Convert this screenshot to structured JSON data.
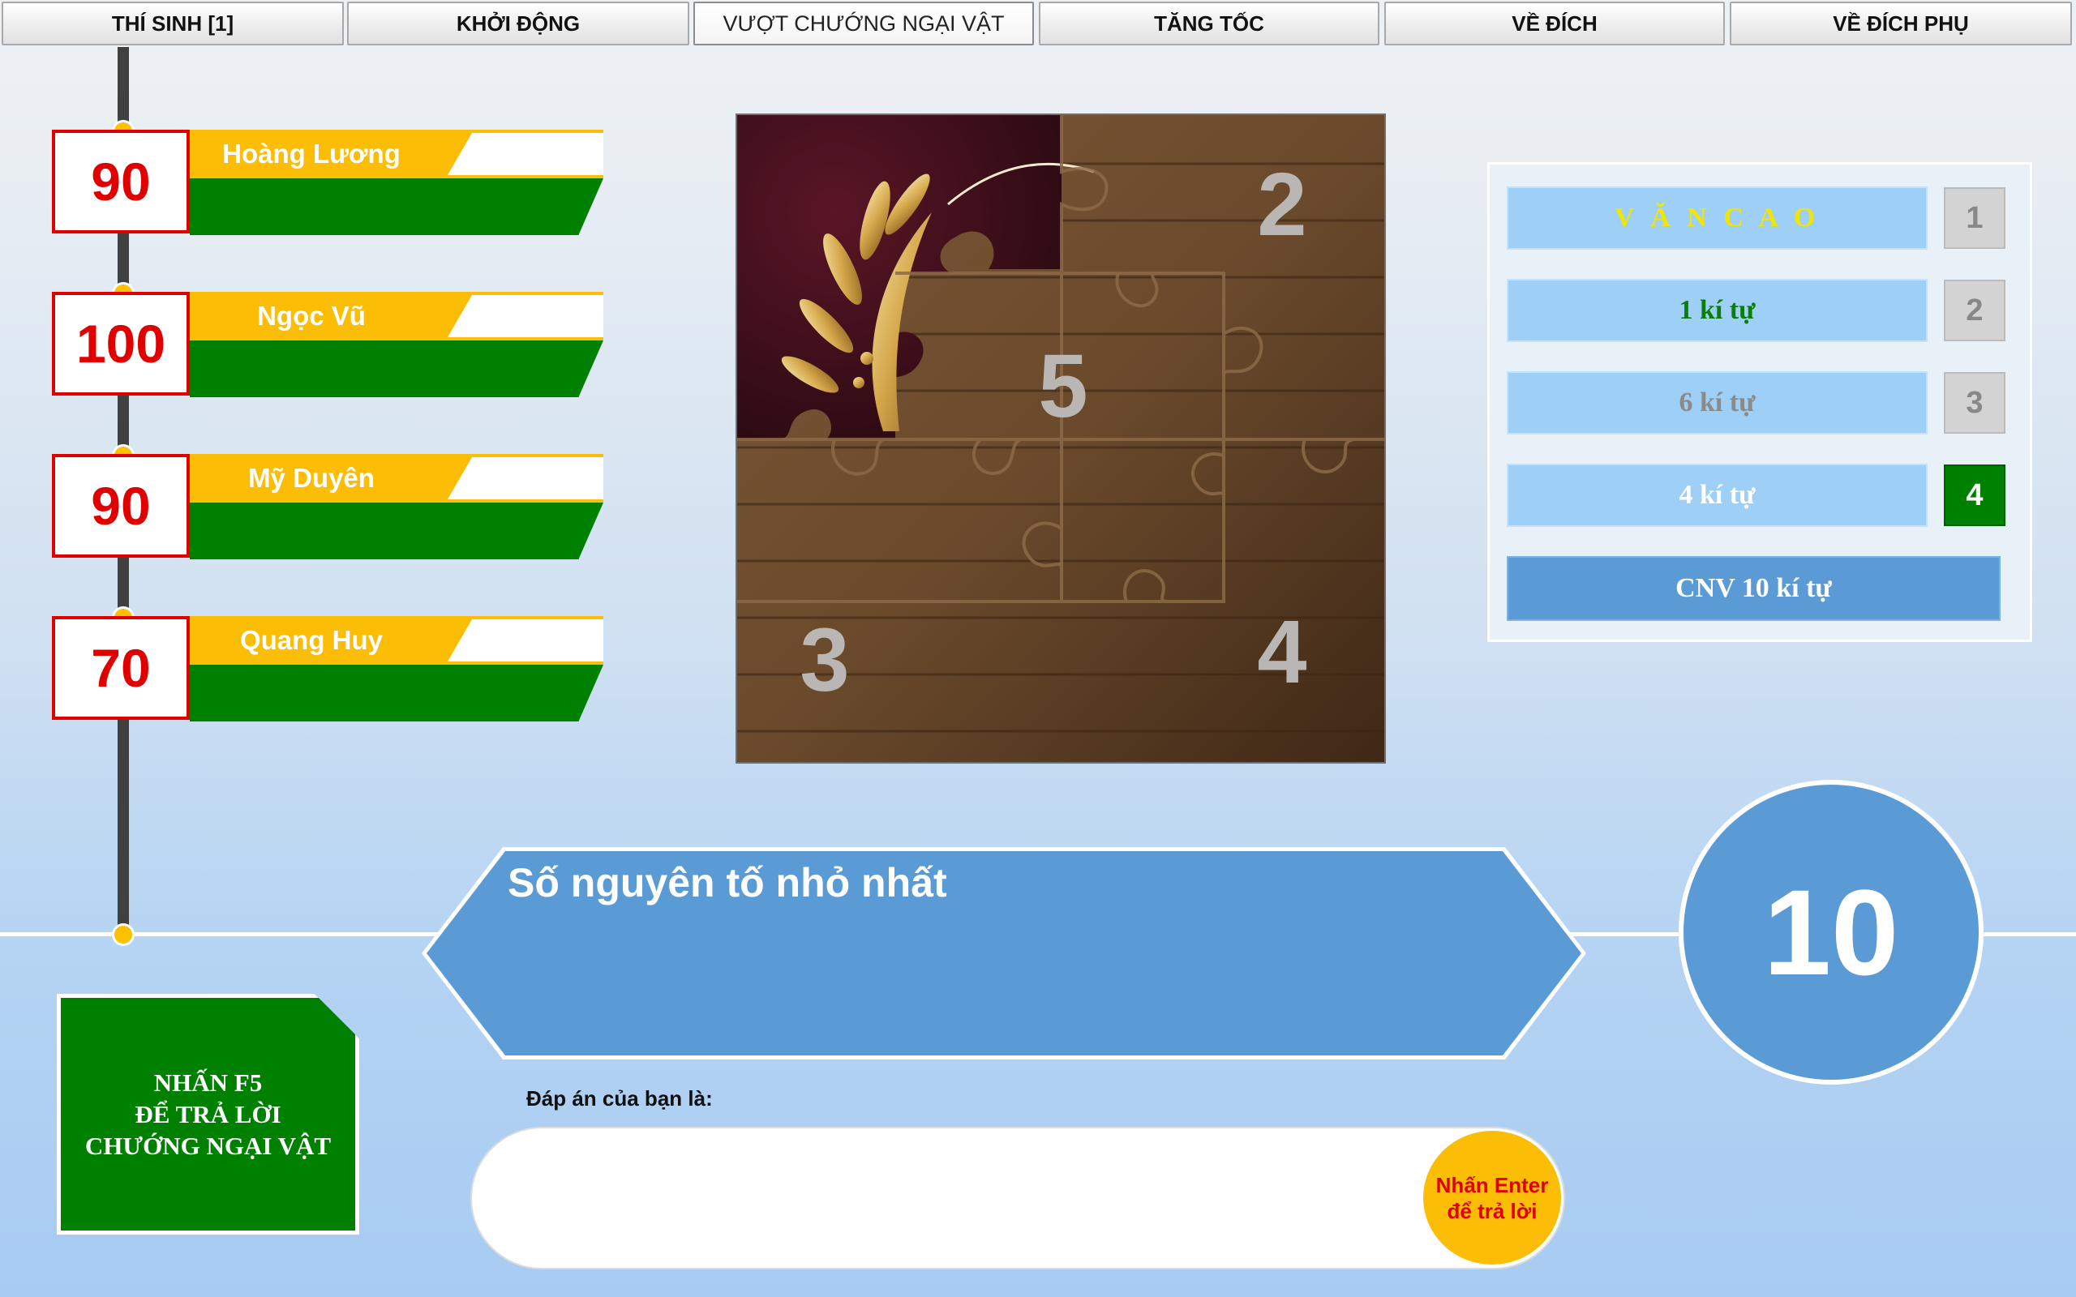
{
  "tabs": [
    {
      "label": "THÍ SINH [1]"
    },
    {
      "label": "KHỞI ĐỘNG"
    },
    {
      "label": "VƯỢT CHƯỚNG NGẠI VẬT"
    },
    {
      "label": "TĂNG TỐC"
    },
    {
      "label": "VỀ ĐÍCH"
    },
    {
      "label": "VỀ ĐÍCH PHỤ"
    }
  ],
  "active_tab": "VƯỢT CHƯỚNG NGẠI VẬT",
  "players": [
    {
      "score": "90",
      "name": "Hoàng Lương"
    },
    {
      "score": "100",
      "name": "Ngọc Vũ"
    },
    {
      "score": "90",
      "name": "Mỹ Duyên"
    },
    {
      "score": "70",
      "name": "Quang Huy"
    }
  ],
  "puzzle": {
    "piece_numbers": [
      "2",
      "5",
      "3",
      "4"
    ]
  },
  "keywords": [
    {
      "text": "V Ă N C A O",
      "number": "1",
      "color": "#f2e600"
    },
    {
      "text": "1 kí tự",
      "number": "2",
      "color": "#0a7d0a"
    },
    {
      "text": "6 kí tự",
      "number": "3",
      "color": "#8a8a8a"
    },
    {
      "text": "4 kí tự",
      "number": "4",
      "color": "#ffffff"
    }
  ],
  "selected_keyword": "4",
  "cnv_label": "CNV 10 kí tự",
  "question": "Số nguyên tố nhỏ nhất",
  "timer": "10",
  "f5_lines": [
    "NHẤN F5",
    "ĐỂ TRẢ LỜI",
    "CHƯỚNG NGẠI VẬT"
  ],
  "answer": {
    "label": "Đáp án của bạn là:",
    "value": "",
    "enter_lines": [
      "Nhấn Enter",
      "để trả lời"
    ]
  },
  "colors": {
    "score_red": "#e00000",
    "name_yellow": "#fbbd06",
    "green": "#008000",
    "keyword_blue": "#9ecff7",
    "hex_blue": "#5b9bd5"
  }
}
